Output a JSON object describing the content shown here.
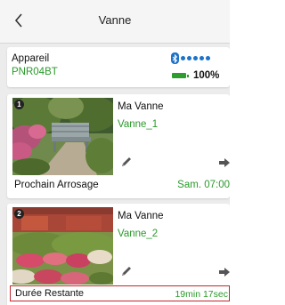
{
  "header": {
    "title": "Vanne",
    "back_icon": "chevron-left-icon"
  },
  "device": {
    "label": "Appareil",
    "id": "PNR04BT",
    "signal_icon": "bluetooth-signal-icon",
    "signal_level": 5,
    "battery_icon": "battery-icon",
    "battery_percent": "100%"
  },
  "valves": [
    {
      "badge": "1",
      "name": "Ma Vanne",
      "id": "Vanne_1",
      "status_label": "Prochain Arrosage",
      "status_value": "Sam. 07:00",
      "highlighted": false
    },
    {
      "badge": "2",
      "name": "Ma Vanne",
      "id": "Vanne_2",
      "status_label": "Durée Restante",
      "status_value": "19min 17sec",
      "highlighted": true
    }
  ],
  "colors": {
    "accent_green": "#2b9a2b",
    "bluetooth_blue": "#1d72c9",
    "highlight_red": "#c1272d"
  }
}
